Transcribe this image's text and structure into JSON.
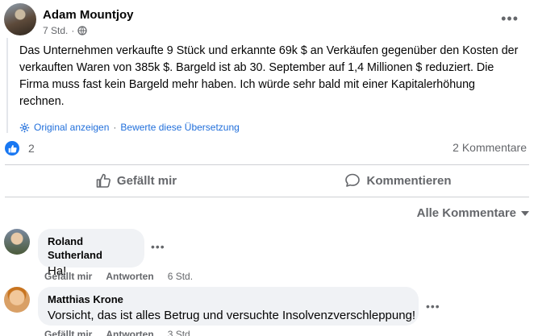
{
  "post": {
    "author": "Adam Mountjoy",
    "time": "7 Std.",
    "dot": "·",
    "more_label": "•••",
    "text": "Das Unternehmen verkaufte 9 Stück und erkannte 69k $ an Verkäufen gegenüber den Kosten der verkauften Waren von 385k $. Bargeld ist ab 30. September auf 1,4 Millionen $ reduziert. Die Firma muss fast kein Bargeld mehr haben. Ich würde sehr bald mit einer Kapitalerhöhung rechnen.",
    "translation": {
      "show_original": "Original anzeigen",
      "separator": "·",
      "rate": "Bewerte diese Übersetzung"
    }
  },
  "reactions": {
    "count": "2",
    "comments_count": "2 Kommentare"
  },
  "actions": {
    "like": "Gefällt mir",
    "comment": "Kommentieren"
  },
  "sort": {
    "label": "Alle Kommentare"
  },
  "comments": [
    {
      "name": "Roland Sutherland",
      "text": "Ha!",
      "like": "Gefällt mir",
      "reply": "Antworten",
      "time": "6 Std.",
      "more_label": "•••"
    },
    {
      "name": "Matthias Krone",
      "text": "Vorsicht, das ist alles Betrug und versuchte Insolvenzverschleppung!",
      "like": "Gefällt mir",
      "reply": "Antworten",
      "time": "3 Std.",
      "more_label": "•••"
    }
  ],
  "colors": {
    "accent": "#1877f2",
    "link": "#216fdb",
    "secondary_text": "#65676b",
    "bubble": "#f0f2f5"
  }
}
